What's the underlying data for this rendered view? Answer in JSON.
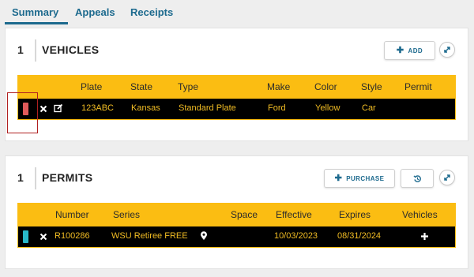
{
  "tabs": [
    {
      "label": "Summary",
      "active": true
    },
    {
      "label": "Appeals",
      "active": false
    },
    {
      "label": "Receipts",
      "active": false
    }
  ],
  "vehicles": {
    "count": "1",
    "title": "VEHICLES",
    "add_label": "ADD",
    "columns": [
      "Plate",
      "State",
      "Type",
      "Make",
      "Color",
      "Style",
      "Permit"
    ],
    "rows": [
      {
        "color": "#e05a5a",
        "plate": "123ABC",
        "state": "Kansas",
        "type": "Standard Plate",
        "make": "Ford",
        "color_name": "Yellow",
        "style": "Car",
        "permit": ""
      }
    ]
  },
  "permits": {
    "count": "1",
    "title": "PERMITS",
    "purchase_label": "PURCHASE",
    "columns": [
      "Number",
      "Series",
      "Space",
      "Effective",
      "Expires",
      "Vehicles"
    ],
    "rows": [
      {
        "color": "#29b8c8",
        "number": "R100286",
        "series": "WSU Retiree FREE",
        "effective": "10/03/2023",
        "expires": "08/31/2024"
      }
    ]
  },
  "colors": {
    "accent": "#1d6a8e",
    "header": "#fbbd12",
    "row_text": "#f2bd24"
  }
}
